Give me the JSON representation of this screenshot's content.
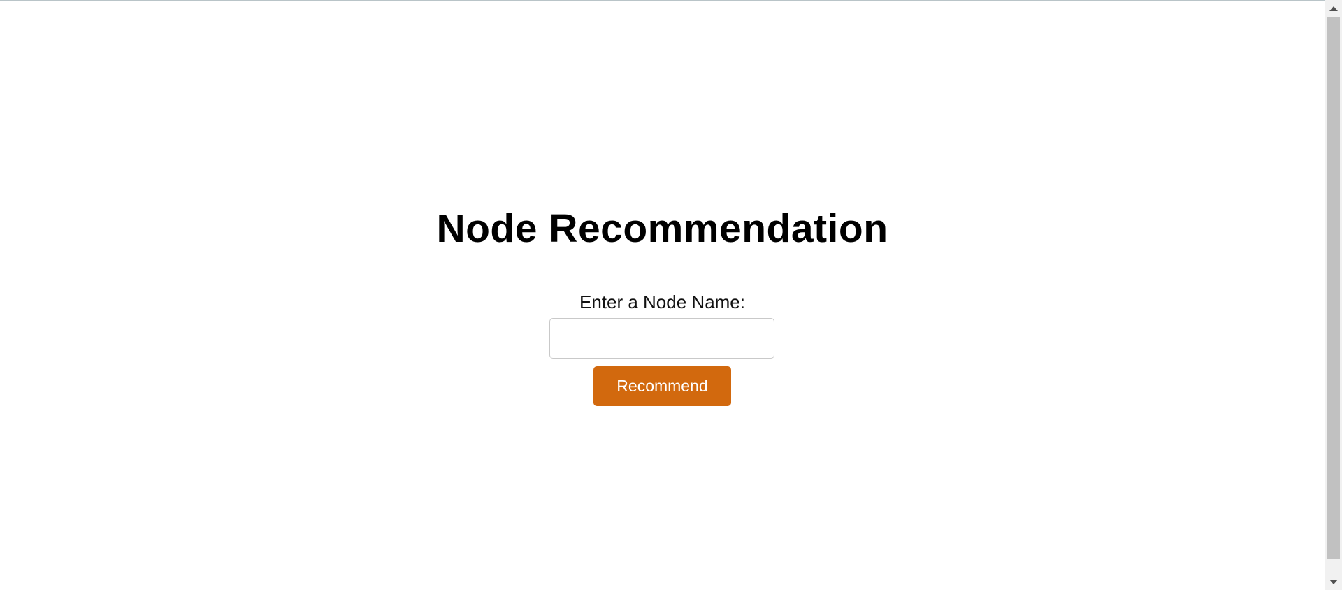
{
  "page": {
    "title": "Node Recommendation",
    "input_label": "Enter a Node Name:",
    "input_value": "",
    "input_placeholder": "",
    "button_label": "Recommend"
  },
  "colors": {
    "button_bg": "#d2690e",
    "button_text": "#ffffff",
    "background": "#ffffff"
  },
  "icons": {
    "scroll_up": "scroll-up-arrow-icon",
    "scroll_down": "scroll-down-arrow-icon"
  }
}
